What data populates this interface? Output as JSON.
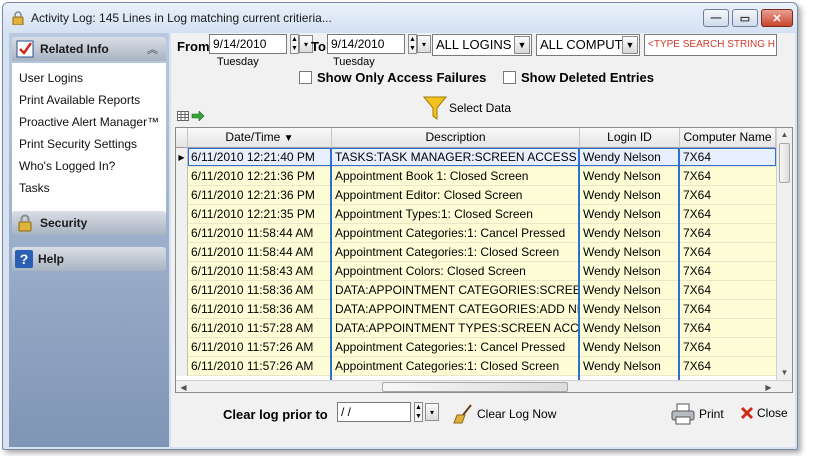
{
  "window": {
    "title": "Activity Log: 145 Lines in Log matching current critieria...",
    "min_glyph": "—",
    "max_glyph": "▭",
    "close_glyph": "✕"
  },
  "sidebar": {
    "related_info": {
      "title": "Related Info",
      "items": [
        {
          "label": "User Logins"
        },
        {
          "label": "Print Available Reports"
        },
        {
          "label": "Proactive Alert Manager™"
        },
        {
          "label": "Print Security Settings"
        },
        {
          "label": "Who's Logged In?"
        },
        {
          "label": "Tasks"
        }
      ]
    },
    "security": {
      "title": "Security"
    },
    "help": {
      "title": "Help",
      "icon_glyph": "?"
    }
  },
  "filters": {
    "from_label": "From",
    "from_date": "9/14/2010",
    "from_day": "Tuesday",
    "to_label": "To",
    "to_date": "9/14/2010",
    "to_day": "Tuesday",
    "logins_value": "ALL LOGINS",
    "computers_value": "ALL COMPUT",
    "search_placeholder": "<TYPE SEARCH STRING H",
    "show_access_failures": "Show Only Access Failures",
    "show_deleted": "Show Deleted Entries",
    "select_data": "Select Data"
  },
  "grid": {
    "columns": [
      {
        "label": "Date/Time",
        "sort": "▼"
      },
      {
        "label": "Description"
      },
      {
        "label": "Login ID"
      },
      {
        "label": "Computer Name"
      }
    ],
    "rows": [
      {
        "datetime": "6/11/2010 12:21:40 PM",
        "desc": "TASKS:TASK MANAGER:SCREEN ACCESS",
        "login": "Wendy Nelson",
        "computer": "7X64"
      },
      {
        "datetime": "6/11/2010 12:21:36 PM",
        "desc": "Appointment Book 1: Closed Screen",
        "login": "Wendy Nelson",
        "computer": "7X64"
      },
      {
        "datetime": "6/11/2010 12:21:36 PM",
        "desc": "Appointment Editor: Closed Screen",
        "login": "Wendy Nelson",
        "computer": "7X64"
      },
      {
        "datetime": "6/11/2010 12:21:35 PM",
        "desc": "Appointment Types:1: Closed Screen",
        "login": "Wendy Nelson",
        "computer": "7X64"
      },
      {
        "datetime": "6/11/2010 11:58:44 AM",
        "desc": "Appointment Categories:1: Cancel Pressed",
        "login": "Wendy Nelson",
        "computer": "7X64"
      },
      {
        "datetime": "6/11/2010 11:58:44 AM",
        "desc": "Appointment Categories:1: Closed Screen",
        "login": "Wendy Nelson",
        "computer": "7X64"
      },
      {
        "datetime": "6/11/2010 11:58:43 AM",
        "desc": "Appointment Colors: Closed Screen",
        "login": "Wendy Nelson",
        "computer": "7X64"
      },
      {
        "datetime": "6/11/2010 11:58:36 AM",
        "desc": "DATA:APPOINTMENT CATEGORIES:SCREEN",
        "login": "Wendy Nelson",
        "computer": "7X64"
      },
      {
        "datetime": "6/11/2010 11:58:36 AM",
        "desc": "DATA:APPOINTMENT CATEGORIES:ADD NEW",
        "login": "Wendy Nelson",
        "computer": "7X64"
      },
      {
        "datetime": "6/11/2010 11:57:28 AM",
        "desc": "DATA:APPOINTMENT TYPES:SCREEN ACCESS",
        "login": "Wendy Nelson",
        "computer": "7X64"
      },
      {
        "datetime": "6/11/2010 11:57:26 AM",
        "desc": "Appointment Categories:1: Cancel Pressed",
        "login": "Wendy Nelson",
        "computer": "7X64"
      },
      {
        "datetime": "6/11/2010 11:57:26 AM",
        "desc": "Appointment Categories:1: Closed Screen",
        "login": "Wendy Nelson",
        "computer": "7X64"
      }
    ]
  },
  "footer": {
    "clear_label": "Clear log prior to",
    "clear_date": " / /",
    "clear_now": "Clear Log Now",
    "print": "Print",
    "close": "Close"
  },
  "colors": {
    "row_bg": "#fefed6",
    "selection": "#2f6fcf",
    "search_text": "#d13b2b"
  }
}
